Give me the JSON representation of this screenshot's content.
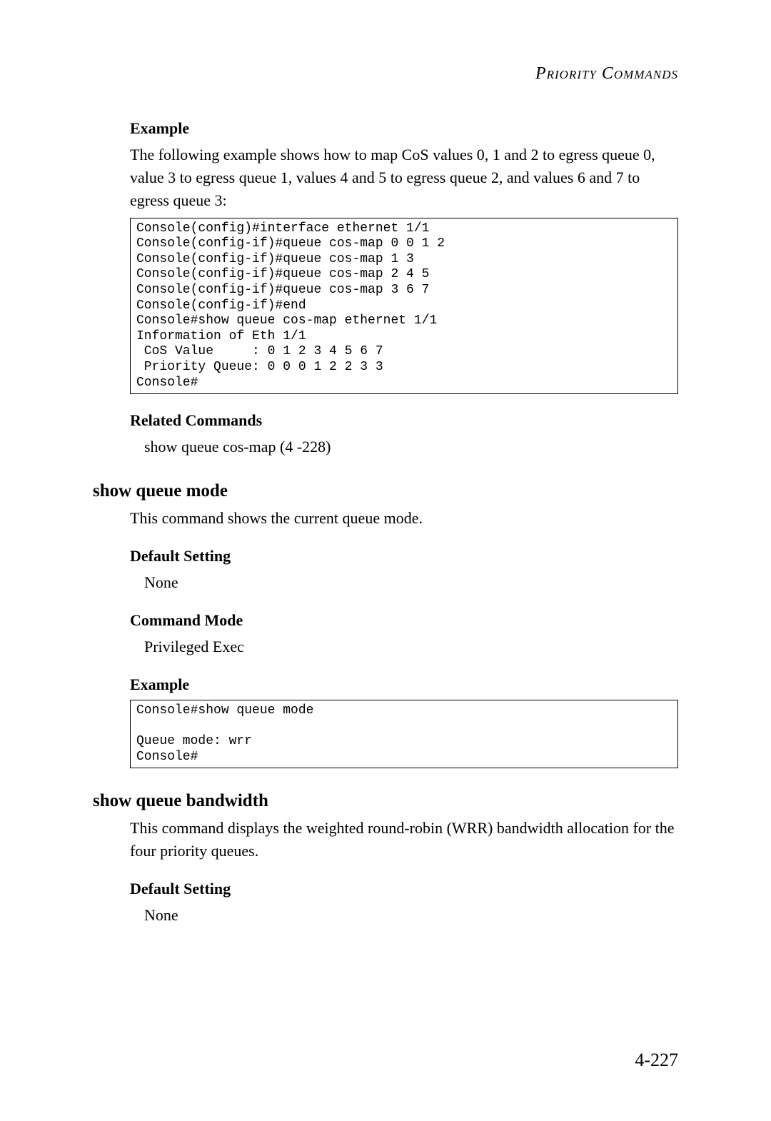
{
  "header": "Priority Commands",
  "sec1": {
    "heading": "Example",
    "body": "The following example shows how to map CoS values 0, 1 and 2 to egress queue 0, value 3 to egress queue 1, values 4 and 5 to egress queue 2, and values 6 and 7 to egress queue 3:",
    "code": "Console(config)#interface ethernet 1/1\nConsole(config-if)#queue cos-map 0 0 1 2\nConsole(config-if)#queue cos-map 1 3\nConsole(config-if)#queue cos-map 2 4 5\nConsole(config-if)#queue cos-map 3 6 7\nConsole(config-if)#end\nConsole#show queue cos-map ethernet 1/1\nInformation of Eth 1/1\n CoS Value     : 0 1 2 3 4 5 6 7\n Priority Queue: 0 0 0 1 2 2 3 3\nConsole#"
  },
  "related": {
    "heading": "Related Commands",
    "text": "show queue cos-map (4 -228)"
  },
  "cmd1": {
    "title": "show queue mode",
    "desc": "This command shows the current queue mode.",
    "defset_h": "Default Setting",
    "defset_v": "None",
    "mode_h": "Command Mode",
    "mode_v": "Privileged Exec",
    "example_h": "Example",
    "code": "Console#show queue mode\n\nQueue mode: wrr\nConsole#"
  },
  "cmd2": {
    "title": "show queue bandwidth",
    "desc": "This command displays the weighted round-robin (WRR) bandwidth allocation for the four priority queues.",
    "defset_h": "Default Setting",
    "defset_v": "None"
  },
  "page_number": "4-227"
}
